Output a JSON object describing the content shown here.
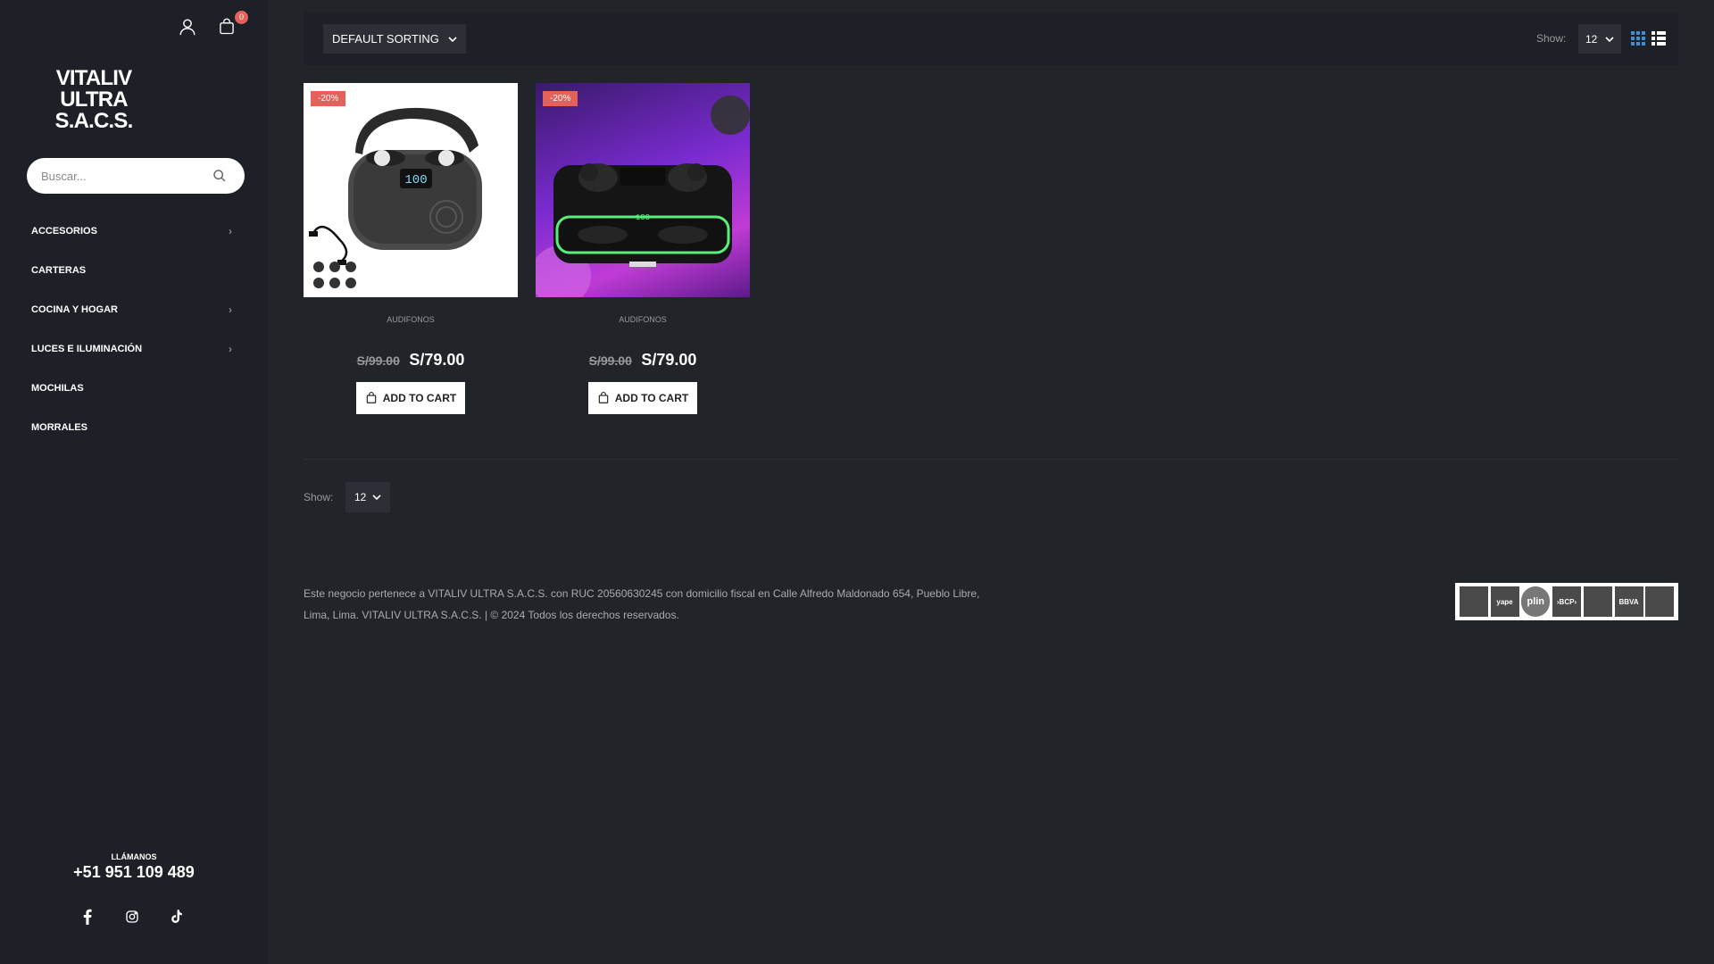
{
  "header": {
    "cart_count": "0"
  },
  "logo": {
    "text": "VITALIV ULTRA S.A.C.S."
  },
  "search": {
    "placeholder": "Buscar..."
  },
  "sidebar": {
    "menu": [
      {
        "label": "ACCESORIOS",
        "has_submenu": true
      },
      {
        "label": "CARTERAS",
        "has_submenu": false
      },
      {
        "label": "COCINA Y HOGAR",
        "has_submenu": true
      },
      {
        "label": "LUCES E ILUMINACIÓN",
        "has_submenu": true
      },
      {
        "label": "MOCHILAS",
        "has_submenu": false
      },
      {
        "label": "MORRALES",
        "has_submenu": false
      }
    ],
    "call_label": "LLÁMANOS",
    "call_number": "+51 951 109 489",
    "socials": [
      "facebook-icon",
      "instagram-icon",
      "tiktok-icon"
    ]
  },
  "toolbar": {
    "sort_label": "DEFAULT SORTING",
    "show_label": "Show:",
    "show_value": "12"
  },
  "products": [
    {
      "badge": "-20%",
      "category": "AUDIFONOS",
      "old_price": "S/99.00",
      "new_price": "S/79.00",
      "button": "ADD TO CART"
    },
    {
      "badge": "-20%",
      "category": "AUDIFONOS",
      "old_price": "S/99.00",
      "new_price": "S/79.00",
      "button": "ADD TO CART"
    }
  ],
  "bottom_pager": {
    "show_label": "Show:",
    "show_value": "12"
  },
  "footer": {
    "text": "Este negocio pertenece a VITALIV ULTRA S.A.C.S. con RUC 20560630245 con domicilio fiscal en Calle Alfredo Maldonado 654, Pueblo Libre, Lima, Lima. VITALIV ULTRA S.A.C.S. | © 2024 Todos los derechos reservados.",
    "payments": [
      "",
      "yape",
      "plin",
      "›BCP›",
      "",
      "BBVA",
      ""
    ]
  },
  "colors": {
    "accent": "#e36159",
    "background": "#212529",
    "sidebar": "#1d2127"
  }
}
